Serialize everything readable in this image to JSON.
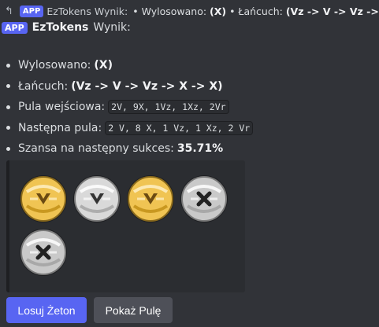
{
  "reply": {
    "badge": "APP",
    "name": "EzTokens Wynik:",
    "text_prefix": "• Wylosowano: ",
    "text_bold": "(X)",
    "text_suffix": " • Łańcuch: ",
    "text_bold2": "(Vz -> V -> Vz -> ..."
  },
  "header": {
    "badge": "APP",
    "bot_name": "EzTokens",
    "text": "Wynik:"
  },
  "info": {
    "drawn_label": "Wylosowano:",
    "drawn_value": "(X)",
    "chain_label": "Łańcuch:",
    "chain_value": "(Vz -> V -> Vz -> X -> X)",
    "input_pool_label": "Pula wejściowa:",
    "input_pool_value": "2V, 9X, 1Vz, 1Xz, 2Vr",
    "next_pool_label": "Następna pula:",
    "next_pool_value": "2 V, 8 X, 1 Vz, 1 Xz, 2 Vr",
    "chance_label": "Szansa na następny sukces:",
    "chance_value": "35.71%"
  },
  "tokens": [
    {
      "type": "Vz",
      "metal": "gold",
      "symbol": "V"
    },
    {
      "type": "V",
      "metal": "silver",
      "symbol": "V"
    },
    {
      "type": "Vz",
      "metal": "gold",
      "symbol": "V"
    },
    {
      "type": "X",
      "metal": "silver",
      "symbol": "X"
    },
    {
      "type": "X",
      "metal": "silver",
      "symbol": "X"
    }
  ],
  "colors": {
    "background": "#313338",
    "embed": "#2b2d31",
    "primary": "#5865f2",
    "secondary": "#4e5058"
  },
  "buttons": {
    "draw": "Losuj Żeton",
    "show_pool": "Pokaż Pulę"
  }
}
